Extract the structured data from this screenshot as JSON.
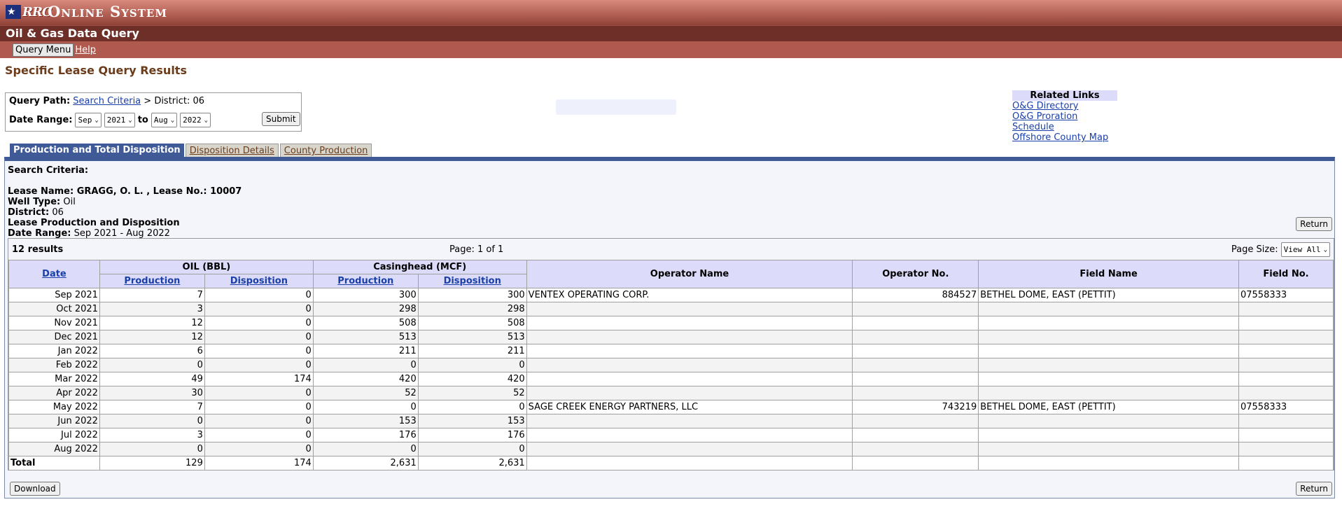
{
  "header": {
    "logo_text": "RRC",
    "system_title": "Online System",
    "app_title": "Oil & Gas Data Query",
    "nav": {
      "query_menu": "Query Menu",
      "help": "Help"
    }
  },
  "page_title": "Specific Lease Query Results",
  "query": {
    "path_label": "Query Path:",
    "path_link": "Search Criteria",
    "path_rest": " > District: 06",
    "date_label": "Date Range:",
    "from_month": "Sep",
    "from_year": "2021",
    "to_label": "to",
    "to_month": "Aug",
    "to_year": "2022",
    "submit": "Submit"
  },
  "related": {
    "title": "Related Links",
    "links": [
      "O&G Directory",
      "O&G Proration Schedule",
      "Offshore County Map"
    ]
  },
  "tabs": [
    "Production and Total Disposition",
    "Disposition Details",
    "County Production"
  ],
  "criteria": {
    "heading": "Search Criteria:",
    "lease_line": "Lease Name: GRAGG, O. L. , Lease No.: 10007",
    "well_type_label": "Well Type:",
    "well_type": "Oil",
    "district_label": "District:",
    "district": "06",
    "report_label": "Lease Production and Disposition",
    "date_range_label": "Date Range:",
    "date_range": "Sep 2021 - Aug 2022"
  },
  "buttons": {
    "return": "Return",
    "download": "Download"
  },
  "results": {
    "count": "12 results",
    "page": "Page: 1 of 1",
    "page_size_label": "Page Size:",
    "page_size": "View All",
    "headers": {
      "date": "Date",
      "oil": "OIL (BBL)",
      "casinghead": "Casinghead (MCF)",
      "production": "Production",
      "disposition": "Disposition",
      "operator_name": "Operator Name",
      "operator_no": "Operator No.",
      "field_name": "Field Name",
      "field_no": "Field No."
    },
    "rows": [
      {
        "date": "Sep 2021",
        "oil_prod": "7",
        "oil_disp": "0",
        "gas_prod": "300",
        "gas_disp": "300",
        "operator_name": "VENTEX OPERATING CORP.",
        "operator_no": "884527",
        "field_name": "BETHEL DOME, EAST (PETTIT)",
        "field_no": "07558333"
      },
      {
        "date": "Oct 2021",
        "oil_prod": "3",
        "oil_disp": "0",
        "gas_prod": "298",
        "gas_disp": "298",
        "operator_name": "",
        "operator_no": "",
        "field_name": "",
        "field_no": ""
      },
      {
        "date": "Nov 2021",
        "oil_prod": "12",
        "oil_disp": "0",
        "gas_prod": "508",
        "gas_disp": "508",
        "operator_name": "",
        "operator_no": "",
        "field_name": "",
        "field_no": ""
      },
      {
        "date": "Dec 2021",
        "oil_prod": "12",
        "oil_disp": "0",
        "gas_prod": "513",
        "gas_disp": "513",
        "operator_name": "",
        "operator_no": "",
        "field_name": "",
        "field_no": ""
      },
      {
        "date": "Jan 2022",
        "oil_prod": "6",
        "oil_disp": "0",
        "gas_prod": "211",
        "gas_disp": "211",
        "operator_name": "",
        "operator_no": "",
        "field_name": "",
        "field_no": ""
      },
      {
        "date": "Feb 2022",
        "oil_prod": "0",
        "oil_disp": "0",
        "gas_prod": "0",
        "gas_disp": "0",
        "operator_name": "",
        "operator_no": "",
        "field_name": "",
        "field_no": ""
      },
      {
        "date": "Mar 2022",
        "oil_prod": "49",
        "oil_disp": "174",
        "gas_prod": "420",
        "gas_disp": "420",
        "operator_name": "",
        "operator_no": "",
        "field_name": "",
        "field_no": ""
      },
      {
        "date": "Apr 2022",
        "oil_prod": "30",
        "oil_disp": "0",
        "gas_prod": "52",
        "gas_disp": "52",
        "operator_name": "",
        "operator_no": "",
        "field_name": "",
        "field_no": ""
      },
      {
        "date": "May 2022",
        "oil_prod": "7",
        "oil_disp": "0",
        "gas_prod": "0",
        "gas_disp": "0",
        "operator_name": "SAGE CREEK ENERGY PARTNERS, LLC",
        "operator_no": "743219",
        "field_name": "BETHEL DOME, EAST (PETTIT)",
        "field_no": "07558333"
      },
      {
        "date": "Jun 2022",
        "oil_prod": "0",
        "oil_disp": "0",
        "gas_prod": "153",
        "gas_disp": "153",
        "operator_name": "",
        "operator_no": "",
        "field_name": "",
        "field_no": ""
      },
      {
        "date": "Jul 2022",
        "oil_prod": "3",
        "oil_disp": "0",
        "gas_prod": "176",
        "gas_disp": "176",
        "operator_name": "",
        "operator_no": "",
        "field_name": "",
        "field_no": ""
      },
      {
        "date": "Aug 2022",
        "oil_prod": "0",
        "oil_disp": "0",
        "gas_prod": "0",
        "gas_disp": "0",
        "operator_name": "",
        "operator_no": "",
        "field_name": "",
        "field_no": ""
      }
    ],
    "total": {
      "label": "Total",
      "oil_prod": "129",
      "oil_disp": "174",
      "gas_prod": "2,631",
      "gas_disp": "2,631"
    }
  }
}
